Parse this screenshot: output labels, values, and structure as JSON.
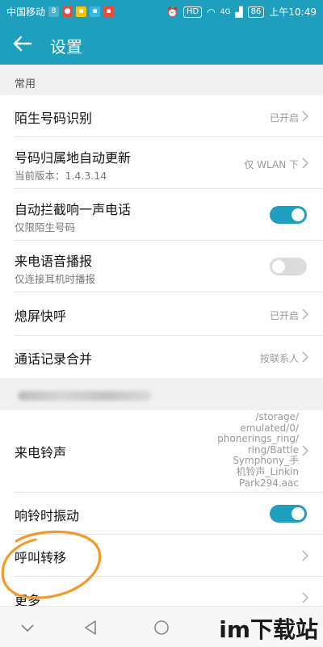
{
  "status_bar": {
    "carrier": "中国移动",
    "battery": "86",
    "network": "4G",
    "hd": "HD",
    "time": "上午10:49"
  },
  "app_bar": {
    "title": "设置",
    "back_icon": "arrow-left-icon"
  },
  "sections": {
    "common": {
      "header": "常用"
    },
    "other": {
      "header_blurred": true
    }
  },
  "rows": {
    "stranger_id": {
      "label": "陌生号码识别",
      "value": "已开启"
    },
    "location_update": {
      "label": "号码归属地自动更新",
      "sub": "当前版本：1.4.3.14",
      "value": "仅 WLAN 下"
    },
    "block_one_ring": {
      "label": "自动拦截响一声电话",
      "sub": "仅限陌生号码",
      "toggle": "on"
    },
    "voice_announce": {
      "label": "来电语音播报",
      "sub": "仅连接耳机时播报",
      "toggle": "off"
    },
    "screen_off_call": {
      "label": "熄屏快呼",
      "value": "已开启"
    },
    "merge_log": {
      "label": "通话记录合并",
      "value": "按联系人"
    },
    "ringtone": {
      "label": "来电铃声",
      "value_lines": [
        "/storage/",
        "emulated/0/",
        "phonerings_ring/",
        "ring/Battle",
        "Symphony_手",
        "机铃声_Linkin",
        "Park294.aac"
      ]
    },
    "vibrate": {
      "label": "响铃时振动",
      "toggle": "on"
    },
    "call_forward": {
      "label": "呼叫转移"
    },
    "more": {
      "label": "更多"
    }
  },
  "watermark": "im下载站",
  "colors": {
    "accent": "#1f9fbe",
    "highlight_circle": "#f39a2c"
  }
}
